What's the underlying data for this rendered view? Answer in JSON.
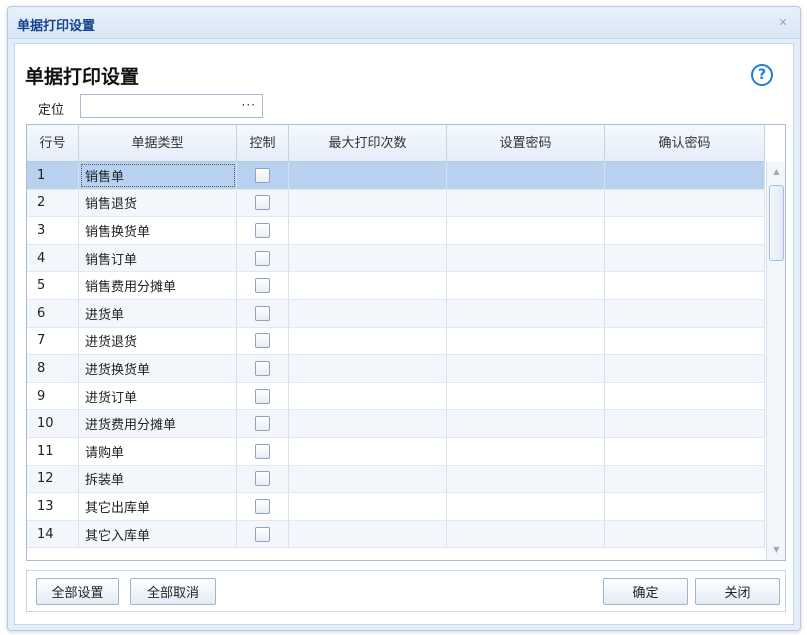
{
  "window": {
    "title": "单据打印设置",
    "close_glyph": "✕"
  },
  "heading": "单据打印设置",
  "help_glyph": "?",
  "locate": {
    "label": "定位",
    "value": "",
    "dots": "···"
  },
  "grid": {
    "columns": [
      "行号",
      "单据类型",
      "控制",
      "最大打印次数",
      "设置密码",
      "确认密码"
    ],
    "rows": [
      {
        "no": "1",
        "type": "销售单"
      },
      {
        "no": "2",
        "type": "销售退货"
      },
      {
        "no": "3",
        "type": "销售换货单"
      },
      {
        "no": "4",
        "type": "销售订单"
      },
      {
        "no": "5",
        "type": "销售费用分摊单"
      },
      {
        "no": "6",
        "type": "进货单"
      },
      {
        "no": "7",
        "type": "进货退货"
      },
      {
        "no": "8",
        "type": "进货换货单"
      },
      {
        "no": "9",
        "type": "进货订单"
      },
      {
        "no": "10",
        "type": "进货费用分摊单"
      },
      {
        "no": "11",
        "type": "请购单"
      },
      {
        "no": "12",
        "type": "拆装单"
      },
      {
        "no": "13",
        "type": "其它出库单"
      },
      {
        "no": "14",
        "type": "其它入库单"
      }
    ],
    "selected_row": 0
  },
  "footer": {
    "set_all": "全部设置",
    "cancel_all": "全部取消",
    "ok": "确定",
    "close": "关闭"
  },
  "colors": {
    "title_text": "#15428b",
    "selected_row": "#b8d1ee",
    "help": "#1b7fd6"
  }
}
